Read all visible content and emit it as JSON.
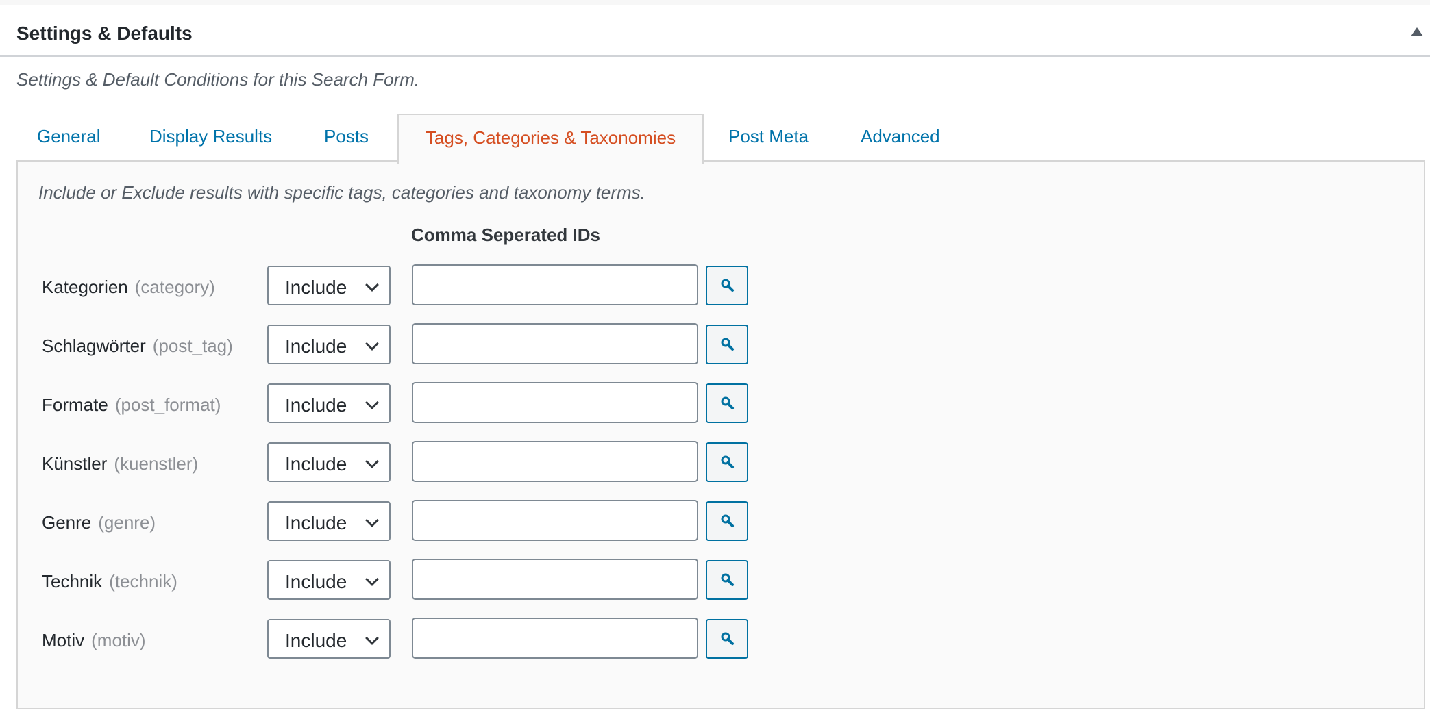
{
  "panel": {
    "title": "Settings & Defaults",
    "description": "Settings & Default Conditions for this Search Form."
  },
  "tabs": [
    {
      "label": "General",
      "active": false
    },
    {
      "label": "Display Results",
      "active": false
    },
    {
      "label": "Posts",
      "active": false
    },
    {
      "label": "Tags, Categories & Taxonomies",
      "active": true
    },
    {
      "label": "Post Meta",
      "active": false
    },
    {
      "label": "Advanced",
      "active": false
    }
  ],
  "taxonomies": {
    "description": "Include or Exclude results with specific tags, categories and taxonomy terms.",
    "ids_header": "Comma Seperated IDs",
    "rows": [
      {
        "label": "Kategorien",
        "slug": "(category)",
        "mode": "Include",
        "ids": ""
      },
      {
        "label": "Schlagwörter",
        "slug": "(post_tag)",
        "mode": "Include",
        "ids": ""
      },
      {
        "label": "Formate",
        "slug": "(post_format)",
        "mode": "Include",
        "ids": ""
      },
      {
        "label": "Künstler",
        "slug": "(kuenstler)",
        "mode": "Include",
        "ids": ""
      },
      {
        "label": "Genre",
        "slug": "(genre)",
        "mode": "Include",
        "ids": ""
      },
      {
        "label": "Technik",
        "slug": "(technik)",
        "mode": "Include",
        "ids": ""
      },
      {
        "label": "Motiv",
        "slug": "(motiv)",
        "mode": "Include",
        "ids": ""
      }
    ]
  },
  "icons": {
    "collapse": "triangle-up-icon",
    "search": "search-icon",
    "dropdown": "chevron-down-icon"
  },
  "colors": {
    "link": "#0073aa",
    "active_tab": "#d54e21",
    "button_border": "#0071a1"
  }
}
